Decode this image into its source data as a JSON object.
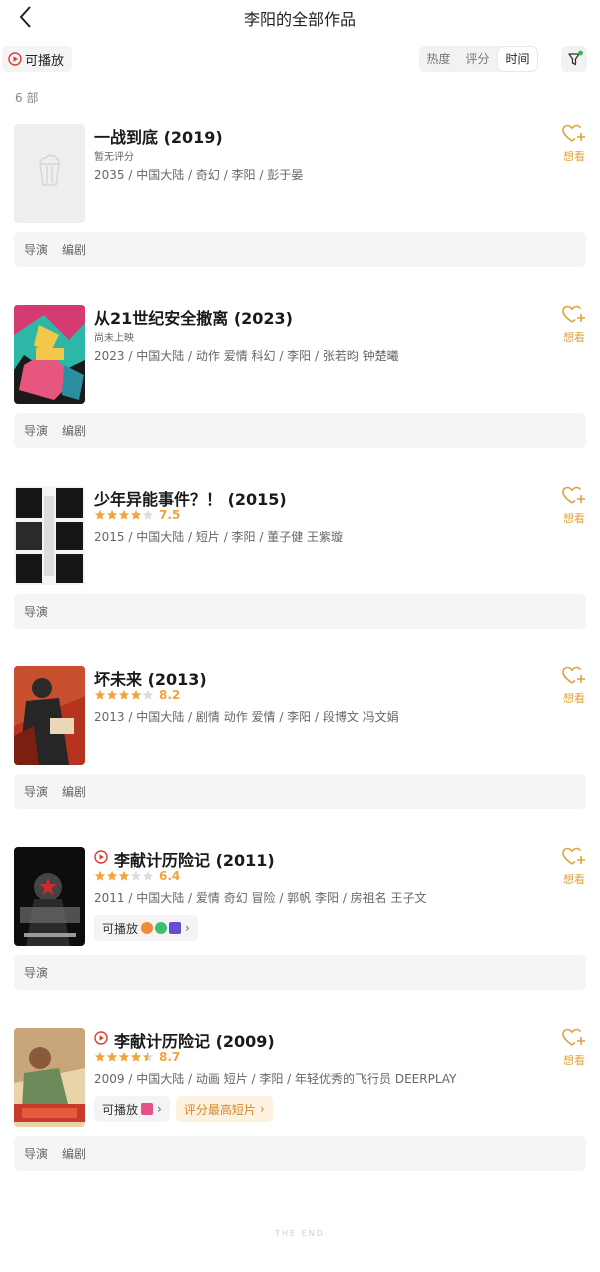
{
  "header": {
    "title": "李阳的全部作品"
  },
  "filters": {
    "playable_label": "可播放",
    "sort_options": [
      "热度",
      "评分",
      "时间"
    ],
    "active_sort": "时间"
  },
  "count_label": "6 部",
  "items": [
    {
      "title": "一战到底 (2019)",
      "rating_text": "暂无评分",
      "meta": "2035 / 中国大陆 / 奇幻 / 李阳 / 彭于晏",
      "want_label": "想看",
      "roles": [
        "导演",
        "编剧"
      ]
    },
    {
      "title": "从21世纪安全撤离 (2023)",
      "rating_text": "尚未上映",
      "meta": "2023 / 中国大陆 / 动作 爱情 科幻 / 李阳 / 张若昀 钟楚曦",
      "want_label": "想看",
      "roles": [
        "导演",
        "编剧"
      ]
    },
    {
      "title": "少年异能事件？！ (2015)",
      "stars": 4,
      "score": "7.5",
      "meta": "2015 / 中国大陆 / 短片 / 李阳 / 董子健 王紫璇",
      "want_label": "想看",
      "roles": [
        "导演"
      ]
    },
    {
      "title": "坏未来 (2013)",
      "stars": 4,
      "score": "8.2",
      "meta": "2013 / 中国大陆 / 剧情 动作 爱情 / 李阳 / 段博文 冯文娟",
      "want_label": "想看",
      "roles": [
        "导演",
        "编剧"
      ]
    },
    {
      "title": "李献计历险记 (2011)",
      "stars": 3,
      "score": "6.4",
      "meta": "2011 / 中国大陆 / 爱情 奇幻 冒险 / 郭帆 李阳 / 房祖名 王子文",
      "want_label": "想看",
      "chips": [
        "可播放"
      ],
      "roles": [
        "导演"
      ]
    },
    {
      "title": "李献计历险记 (2009)",
      "stars": 4.5,
      "score": "8.7",
      "meta": "2009 / 中国大陆 / 动画 短片 / 李阳 / 年轻优秀的飞行员 DEERPLAY",
      "want_label": "想看",
      "chips": [
        "可播放",
        "评分最高短片"
      ],
      "roles": [
        "导演",
        "编剧"
      ]
    }
  ],
  "footer": "THE END",
  "colors": {
    "accent": "#e0a33c",
    "star": "#f2a33a",
    "play_red": "#e03c2e"
  }
}
